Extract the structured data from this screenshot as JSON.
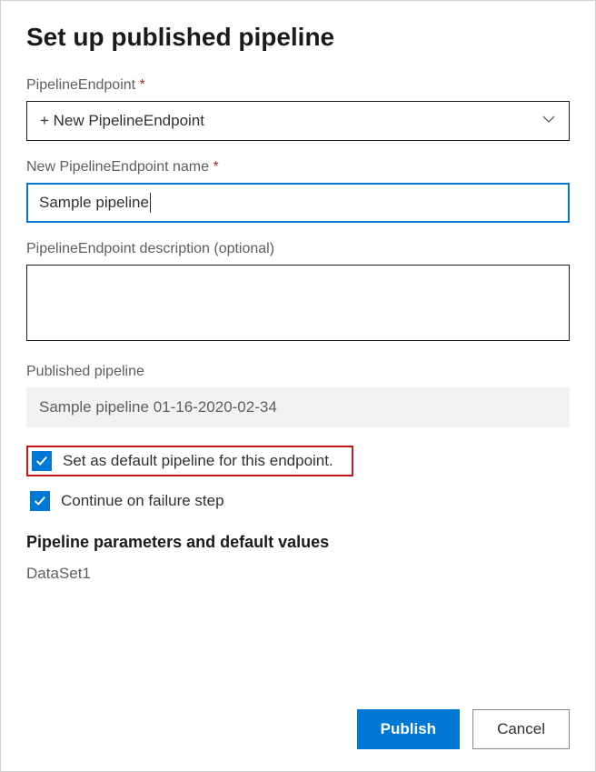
{
  "title": "Set up published pipeline",
  "fields": {
    "pipelineEndpoint": {
      "label": "PipelineEndpoint",
      "value": "+ New PipelineEndpoint"
    },
    "newName": {
      "label": "New PipelineEndpoint name",
      "value": "Sample pipeline"
    },
    "description": {
      "label": "PipelineEndpoint description (optional)",
      "value": ""
    },
    "publishedPipeline": {
      "label": "Published pipeline",
      "value": "Sample pipeline 01-16-2020-02-34"
    }
  },
  "checkboxes": {
    "setDefault": {
      "label": "Set as default pipeline for this endpoint.",
      "checked": true
    },
    "continueOnFailure": {
      "label": "Continue on failure step",
      "checked": true
    }
  },
  "parametersSection": {
    "header": "Pipeline parameters and default values",
    "params": [
      "DataSet1"
    ]
  },
  "buttons": {
    "publish": "Publish",
    "cancel": "Cancel"
  }
}
